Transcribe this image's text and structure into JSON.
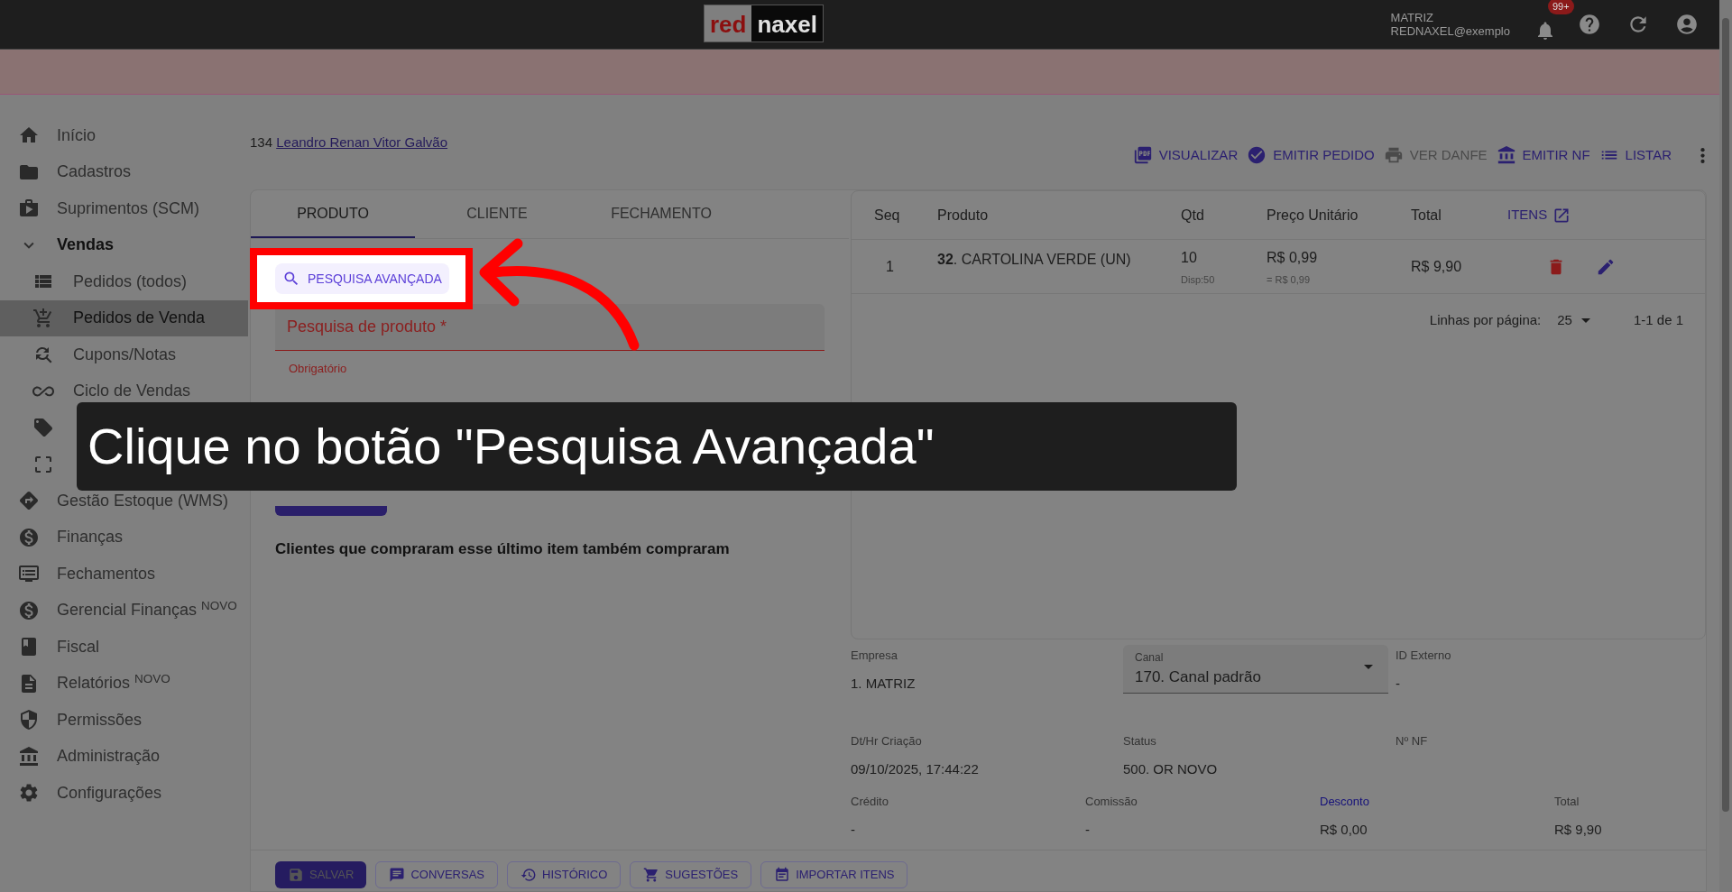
{
  "topbar": {
    "logo": {
      "part_1": "red",
      "part_2": "naxel"
    },
    "company": "MATRIZ",
    "user": "REDNAXEL@exemplo",
    "notifications_badge": "99+"
  },
  "sidebar": {
    "items": [
      {
        "label": "Início"
      },
      {
        "label": "Cadastros"
      },
      {
        "label": "Suprimentos (SCM)"
      },
      {
        "label": "Vendas",
        "expanded": true,
        "children": [
          {
            "label": "Pedidos (todos)",
            "selected": false
          },
          {
            "label": "Pedidos de Venda",
            "selected": true
          },
          {
            "label": "Cupons/Notas",
            "selected": false
          },
          {
            "label": "Ciclo de Vendas",
            "selected": false
          },
          {
            "selected": false
          },
          {
            "selected": false
          }
        ]
      },
      {
        "label": "Gestão Estoque (WMS)"
      },
      {
        "label": "Finanças"
      },
      {
        "label": "Fechamentos"
      },
      {
        "label": "Gerencial Finanças $^{NOVO}$"
      },
      {
        "label": "Fiscal"
      },
      {
        "label": "Relatórios $^{NOVO}$"
      },
      {
        "label": "Permissões"
      },
      {
        "label": "Administração"
      },
      {
        "label": "Configurações"
      }
    ]
  },
  "customer": {
    "number": "134",
    "name": "Leandro Renan Vitor Galvão"
  },
  "toolbar": [
    {
      "label": "VISUALIZAR",
      "disabled": false
    },
    {
      "label": "EMITIR PEDIDO",
      "disabled": false
    },
    {
      "label": "VER DANFE",
      "disabled": true
    },
    {
      "label": "EMITIR NF",
      "disabled": false
    },
    {
      "label": "LISTAR",
      "disabled": false
    }
  ],
  "tabs": [
    {
      "label": "PRODUTO",
      "selected": true
    },
    {
      "label": "CLIENTE",
      "selected": false
    },
    {
      "label": "FECHAMENTO",
      "selected": false
    }
  ],
  "advanced_search_button": "PESQUISA AVANÇADA",
  "product_search": {
    "label": "Pesquisa de produto *",
    "helper": "Obrigatório"
  },
  "recommendations_title": "Clientes que compraram esse último item também compraram",
  "table": {
    "columns": [
      "Seq",
      "Produto",
      "Qtd",
      "Preço Unitário",
      "Total"
    ],
    "items_link": "ITENS",
    "rows": [
      {
        "seq": "1",
        "product": "**32**. CARTOLINA VERDE (UN)",
        "qty": "10",
        "stock": "Disp:50",
        "price": "R$ 0,99",
        "price_note": "= R$ 0,99",
        "total": "R$ 9,90"
      }
    ],
    "pagination": {
      "label": "Linhas por página:",
      "per_page": "25",
      "range": "1-1 de 1"
    }
  },
  "info": [
    [
      {
        "label": "Empresa",
        "value": "1. MATRIZ",
        "kind": "text"
      },
      {
        "label": "Canal",
        "value": "170. Canal padrão",
        "kind": "select"
      },
      {
        "label": "ID Externo",
        "value": "-",
        "kind": "text"
      }
    ],
    [
      {
        "label": "Dt/Hr Criação",
        "value": "09/10/2025, 17:44:22",
        "kind": "text"
      },
      {
        "label": "Status",
        "value": "500. OR NOVO",
        "kind": "text"
      },
      {
        "label": "Nº NF",
        "kind": "text"
      }
    ],
    [
      {
        "label": "Crédito",
        "value": "-",
        "kind": "text"
      },
      {
        "label": "Comissão",
        "value": "-",
        "kind": "text"
      },
      {
        "label": "Desconto",
        "value": "R$ 0,00",
        "kind": "link"
      },
      {
        "label": "Total",
        "value": "R$ 9,90",
        "kind": "text"
      }
    ]
  ],
  "bottom_buttons": [
    {
      "label": "SALVAR",
      "primary": true
    },
    {
      "label": "CONVERSAS",
      "primary": false
    },
    {
      "label": "HISTÓRICO",
      "primary": false
    },
    {
      "label": "SUGESTÕES",
      "primary": false
    },
    {
      "label": "IMPORTAR ITENS",
      "primary": false
    }
  ],
  "caption": "Clique no botão \"Pesquisa Avançada\""
}
